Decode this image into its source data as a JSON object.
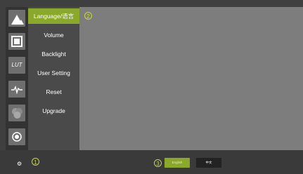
{
  "menu": {
    "items": [
      {
        "label": "Language/语言",
        "active": true
      },
      {
        "label": "Volume",
        "active": false
      },
      {
        "label": "Backlight",
        "active": false
      },
      {
        "label": "User Setting",
        "active": false
      },
      {
        "label": "Reset",
        "active": false
      },
      {
        "label": "Upgrade",
        "active": false
      }
    ]
  },
  "rail": {
    "items": [
      {
        "icon": "mountain-image-icon"
      },
      {
        "icon": "frame-icon"
      },
      {
        "icon": "lut-icon",
        "text": "LUT"
      },
      {
        "icon": "waveform-icon"
      },
      {
        "icon": "color-circles-icon"
      },
      {
        "icon": "record-icon"
      }
    ]
  },
  "callouts": {
    "one": "1",
    "two": "2",
    "three": "3"
  },
  "language": {
    "english": "English",
    "chinese": "中文"
  },
  "colors": {
    "accent": "#8aa82a",
    "callout": "#c8d640"
  }
}
